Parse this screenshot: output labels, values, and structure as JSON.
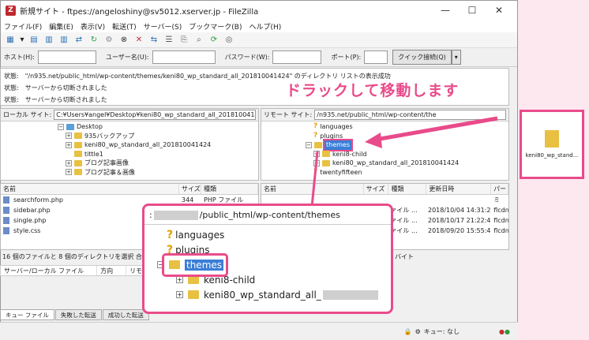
{
  "window": {
    "title": "新規サイト - ftpes://angeloshiny@sv5012.xserver.jp - FileZilla",
    "min": "—",
    "max": "☐",
    "close": "✕"
  },
  "menu": [
    "ファイル(F)",
    "編集(E)",
    "表示(V)",
    "転送(T)",
    "サーバー(S)",
    "ブックマーク(B)",
    "ヘルプ(H)"
  ],
  "quickconnect": {
    "host_label": "ホスト(H):",
    "user_label": "ユーザー名(U):",
    "pass_label": "パスワード(W):",
    "port_label": "ポート(P):",
    "button": "クイック接続(Q)"
  },
  "log": [
    {
      "status": "状態:",
      "text": "\"/n935.net/public_html/wp-content/themes/keni80_wp_standard_all_201810041424\" のディレクトリ リストの表示成功"
    },
    {
      "status": "状態:",
      "text": "サーバーから切断されました"
    },
    {
      "status": "状態:",
      "text": "サーバーから切断されました"
    }
  ],
  "local": {
    "site_label": "ローカル サイト:",
    "site_path": "C:¥Users¥angel¥Desktop¥keni80_wp_standard_all_201810041424¥",
    "tree": [
      "Desktop",
      "935バックアップ",
      "keni80_wp_standard_all_201810041424",
      "tittle1",
      "ブログ記事画像",
      "ブログ記事＆画像"
    ],
    "headers": [
      "名前",
      "サイズ",
      "種類"
    ],
    "files": [
      {
        "name": "searchform.php",
        "size": "344",
        "type": "PHP ファイル"
      },
      {
        "name": "sidebar.php",
        "size": "",
        "type": ""
      },
      {
        "name": "single.php",
        "size": "",
        "type": ""
      },
      {
        "name": "style.css",
        "size": "",
        "type": ""
      }
    ],
    "status": "16 個のファイルと 8 個のディレクトリを選択 合計サイズ"
  },
  "remote": {
    "site_label": "リモート サイト:",
    "site_path": "/n935.net/public_html/wp-content/the",
    "tree": [
      "languages",
      "plugins",
      "themes",
      "keni8-child",
      "keni80_wp_standard_all_201810041424",
      "twentyfifteen"
    ],
    "headers": [
      "名前",
      "サイズ",
      "種類",
      "更新日時",
      "パーミ"
    ],
    "files": [
      {
        "type": "ァイル ...",
        "date": "2018/10/04 14:31:21",
        "perm": "flcdn"
      },
      {
        "type": "ァイル ...",
        "date": "2018/10/17 21:22:41",
        "perm": "flcdn"
      },
      {
        "type": "ァイル ...",
        "date": "2018/09/20 15:55:43",
        "perm": "flcdn"
      }
    ],
    "status": "バイト"
  },
  "queue": {
    "headers": [
      "サーバー/ローカル ファイル",
      "方向",
      "リモート ファイ"
    ],
    "tabs": [
      "キュー ファイル",
      "失敗した転送",
      "成功した転送"
    ],
    "queue_status": "キュー: なし"
  },
  "callout": "ドラックして移動します",
  "zoom": {
    "path": "/public_html/wp-content/themes",
    "prefix": ":",
    "items": [
      "languages",
      "plugins",
      "themes",
      "keni8-child",
      "keni80_wp_standard_all_"
    ]
  },
  "desktop_folder": "keni80_wp_stand..."
}
